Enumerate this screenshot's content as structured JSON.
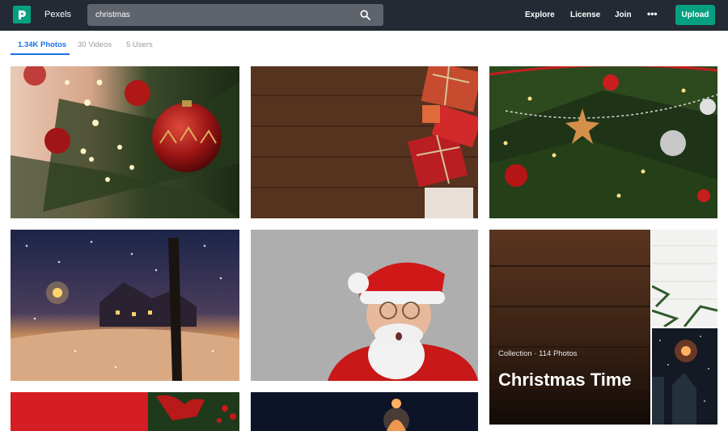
{
  "header": {
    "brand": "Pexels",
    "search_value": "christmas",
    "nav": [
      "Explore",
      "License",
      "Join"
    ],
    "more_icon": "ellipsis-icon",
    "upload_label": "Upload"
  },
  "tabs": [
    {
      "label": "1.34K Photos",
      "active": true
    },
    {
      "label": "30 Videos",
      "active": false
    },
    {
      "label": "5 Users",
      "active": false
    }
  ],
  "photos": [
    {
      "name": "christmas-ornament-tree"
    },
    {
      "name": "wooden-board-gift-boxes"
    },
    {
      "name": "decorated-christmas-tree-closeup"
    },
    {
      "name": "snowy-winter-night-house"
    },
    {
      "name": "surprised-santa-claus"
    },
    {
      "name": "red-ribbon-bow"
    },
    {
      "name": "glowing-ornament-dark"
    },
    {
      "name": "white-wood-pine-branches"
    },
    {
      "name": "snowy-night-lights"
    }
  ],
  "collection": {
    "subtitle": "Collection · 114 Photos",
    "title": "Christmas Time"
  },
  "colors": {
    "topbar": "#232a34",
    "accent": "#05a081",
    "tab_active": "#1a73e8"
  }
}
